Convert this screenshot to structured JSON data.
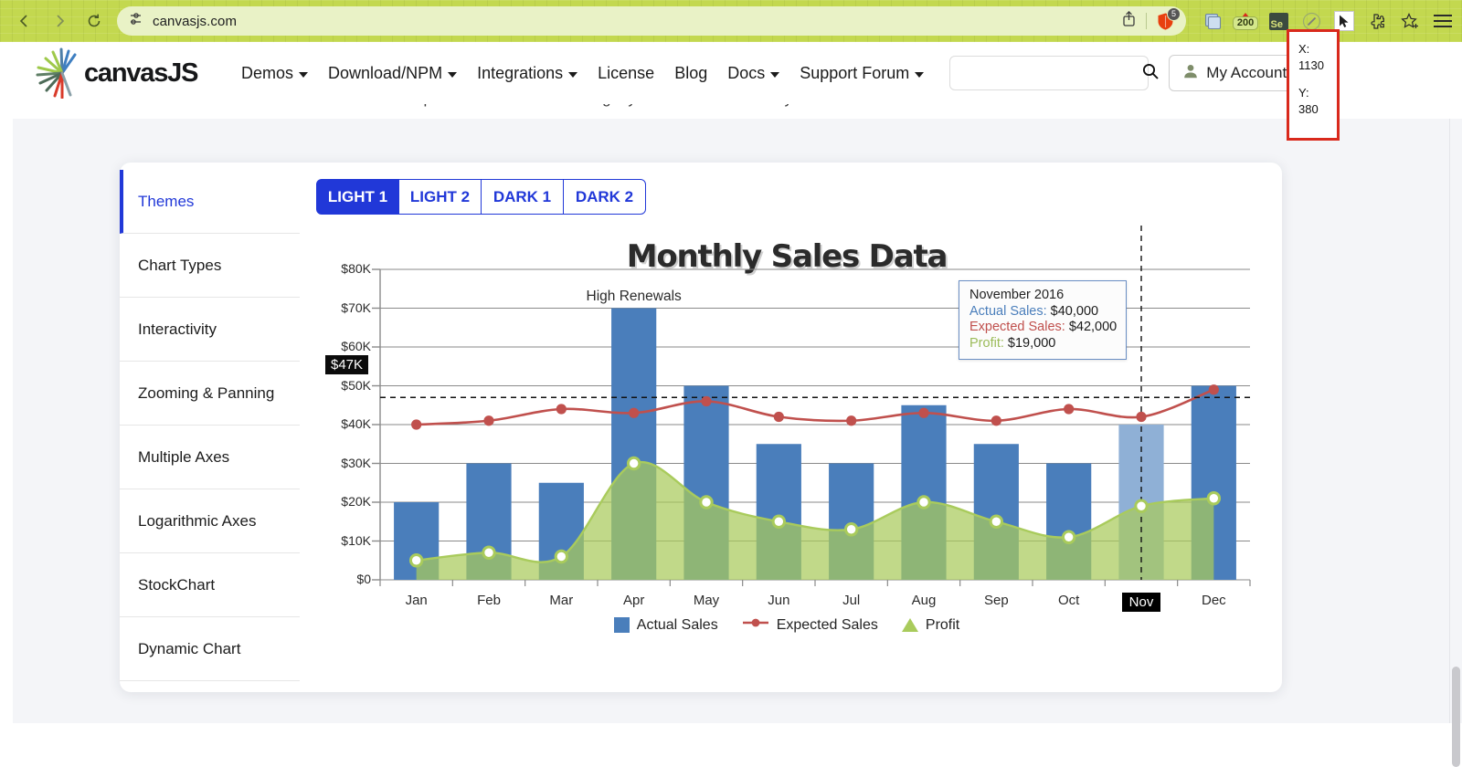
{
  "browser": {
    "url": "canvasjs.com",
    "back_icon": "back-arrow-icon",
    "forward_icon": "forward-arrow-icon",
    "reload_icon": "reload-icon",
    "site_settings_icon": "site-settings-icon",
    "share_icon": "share-icon",
    "shield_icon": "brave-shield-icon",
    "shield_badge": "5",
    "extensions": [
      {
        "name": "screenshot-extension-icon",
        "label": ""
      },
      {
        "name": "zoom-200-extension-icon",
        "label": "200"
      },
      {
        "name": "selenium-extension-icon",
        "label": "Se"
      },
      {
        "name": "pen-extension-icon",
        "label": ""
      },
      {
        "name": "cursor-extension-icon",
        "label": ""
      },
      {
        "name": "puzzle-extensions-icon",
        "label": ""
      },
      {
        "name": "bookmark-star-icon",
        "label": ""
      }
    ],
    "menu_icon": "hamburger-menu-icon"
  },
  "coordinate_overlay": {
    "x_label": "X:",
    "x_value": "1130",
    "y_label": "Y:",
    "y_value": "380",
    "border_color": "#d9291c"
  },
  "site_header": {
    "brand": "canvasJS",
    "nav": [
      {
        "label": "Demos",
        "has_caret": true
      },
      {
        "label": "Download/NPM",
        "has_caret": true
      },
      {
        "label": "Integrations",
        "has_caret": true
      },
      {
        "label": "License",
        "has_caret": false
      },
      {
        "label": "Blog",
        "has_caret": false
      },
      {
        "label": "Docs",
        "has_caret": true
      },
      {
        "label": "Support Forum",
        "has_caret": true
      }
    ],
    "search": {
      "value": "",
      "placeholder": "",
      "icon": "search-icon"
    },
    "account_button": {
      "label": "My Account",
      "icon": "user-icon"
    }
  },
  "page": {
    "subtitle": "Checkout some of the features CanvasJS provides out of the box to get you started immediately"
  },
  "sidebar": {
    "items": [
      {
        "label": "Themes",
        "active": true
      },
      {
        "label": "Chart Types",
        "active": false
      },
      {
        "label": "Interactivity",
        "active": false
      },
      {
        "label": "Zooming & Panning",
        "active": false
      },
      {
        "label": "Multiple Axes",
        "active": false
      },
      {
        "label": "Logarithmic Axes",
        "active": false
      },
      {
        "label": "StockChart",
        "active": false
      },
      {
        "label": "Dynamic Chart",
        "active": false
      }
    ]
  },
  "theme_tabs": [
    {
      "label": "LIGHT 1",
      "active": true
    },
    {
      "label": "LIGHT 2",
      "active": false
    },
    {
      "label": "DARK 1",
      "active": false
    },
    {
      "label": "DARK 2",
      "active": false
    }
  ],
  "tooltip": {
    "title": "November 2016",
    "rows": [
      {
        "key": "Actual Sales:",
        "value": "$40,000",
        "color": "#4a7ebb"
      },
      {
        "key": "Expected Sales:",
        "value": "$42,000",
        "color": "#c0504d"
      },
      {
        "key": "Profit:",
        "value": "$19,000",
        "color": "#9bbb59"
      }
    ]
  },
  "crosshair": {
    "y_label": "$47K",
    "x_label": "Nov"
  },
  "chart_data": {
    "type": "bar",
    "title": "Monthly Sales Data",
    "xlabel": "",
    "ylabel": "",
    "ylim": [
      0,
      80000
    ],
    "grid": true,
    "legend_position": "bottom",
    "categories": [
      "Jan",
      "Feb",
      "Mar",
      "Apr",
      "May",
      "Jun",
      "Jul",
      "Aug",
      "Sep",
      "Oct",
      "Nov",
      "Dec"
    ],
    "ytick_labels": [
      "$0",
      "$10K",
      "$20K",
      "$30K",
      "$40K",
      "$50K",
      "$60K",
      "$70K",
      "$80K"
    ],
    "ytick_values": [
      0,
      10000,
      20000,
      30000,
      40000,
      50000,
      60000,
      70000,
      80000
    ],
    "annotations": [
      {
        "text": "High Renewals",
        "category": "Apr",
        "value": 72000
      }
    ],
    "series": [
      {
        "name": "Actual Sales",
        "type": "column",
        "color": "#4a7ebb",
        "values": [
          20000,
          30000,
          25000,
          70000,
          50000,
          35000,
          30000,
          45000,
          35000,
          30000,
          40000,
          50000
        ]
      },
      {
        "name": "Expected Sales",
        "type": "spline",
        "color": "#c0504d",
        "values": [
          40000,
          41000,
          44000,
          43000,
          46000,
          42000,
          41000,
          43000,
          41000,
          44000,
          42000,
          49000
        ]
      },
      {
        "name": "Profit",
        "type": "splineArea",
        "color": "#a9cb5c",
        "values": [
          5000,
          7000,
          6000,
          30000,
          20000,
          15000,
          13000,
          20000,
          15000,
          11000,
          19000,
          21000
        ]
      }
    ]
  }
}
